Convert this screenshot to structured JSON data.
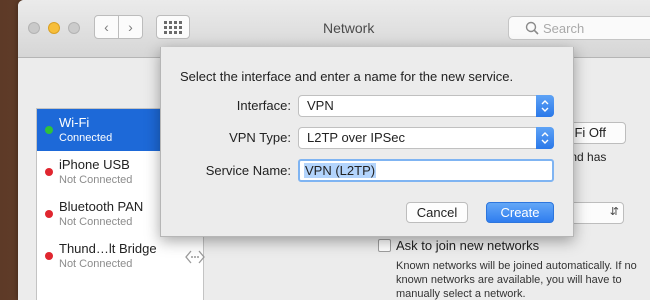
{
  "window": {
    "title": "Network",
    "search_placeholder": "Search"
  },
  "services": [
    {
      "name": "Wi-Fi",
      "status": "Connected",
      "dot_color": "#2fc23a",
      "selected": true
    },
    {
      "name": "iPhone USB",
      "status": "Not Connected",
      "dot_color": "#e0262f",
      "selected": false
    },
    {
      "name": "Bluetooth PAN",
      "status": "Not Connected",
      "dot_color": "#e0262f",
      "selected": false
    },
    {
      "name": "Thund…lt Bridge",
      "status": "Not Connected",
      "dot_color": "#e0262f",
      "selected": false
    }
  ],
  "right_panel": {
    "wifi_off_button": "Wi-Fi Off",
    "text_fragment_1": "F and has",
    "ask_label": "Ask to join new networks",
    "description": "Known networks will be joined automatically. If no known networks are available, you will have to manually select a network."
  },
  "sheet": {
    "prompt": "Select the interface and enter a name for the new service.",
    "interface_label": "Interface:",
    "interface_value": "VPN",
    "vpn_type_label": "VPN Type:",
    "vpn_type_value": "L2TP over IPSec",
    "service_name_label": "Service Name:",
    "service_name_value": "VPN (L2TP)",
    "cancel_label": "Cancel",
    "create_label": "Create"
  },
  "colors": {
    "accent": "#2f7def",
    "selection": "#1d69d8",
    "connected": "#2fc23a",
    "disconnected": "#e0262f"
  }
}
